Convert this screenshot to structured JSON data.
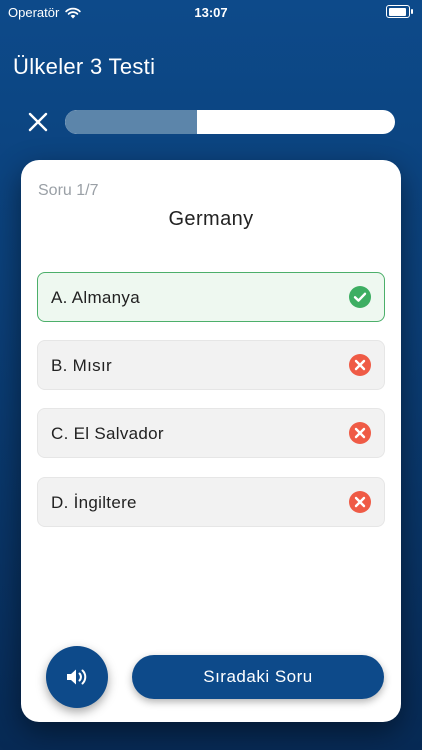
{
  "status_bar": {
    "carrier": "Operatör",
    "time": "13:07",
    "wifi_icon": "wifi-icon",
    "battery_icon": "battery-icon"
  },
  "header": {
    "title": "Ülkeler 3 Testi",
    "close_icon": "close-icon"
  },
  "progress": {
    "fraction": 0.4
  },
  "quiz": {
    "counter": "Soru 1/7",
    "question": "Germany",
    "options": [
      {
        "label": "A. Almanya",
        "status": "correct",
        "icon": "check-circle-icon"
      },
      {
        "label": "B. Mısır",
        "status": "wrong",
        "icon": "x-circle-icon"
      },
      {
        "label": "C. El Salvador",
        "status": "wrong",
        "icon": "x-circle-icon"
      },
      {
        "label": "D. İngiltere",
        "status": "wrong",
        "icon": "x-circle-icon"
      }
    ]
  },
  "actions": {
    "sound_icon": "speaker-icon",
    "next_label": "Sıradaki Soru"
  },
  "colors": {
    "primary": "#0d4a8a",
    "correct": "#3dae62",
    "wrong": "#ef5b46",
    "progress_fill": "#5c85aa"
  }
}
